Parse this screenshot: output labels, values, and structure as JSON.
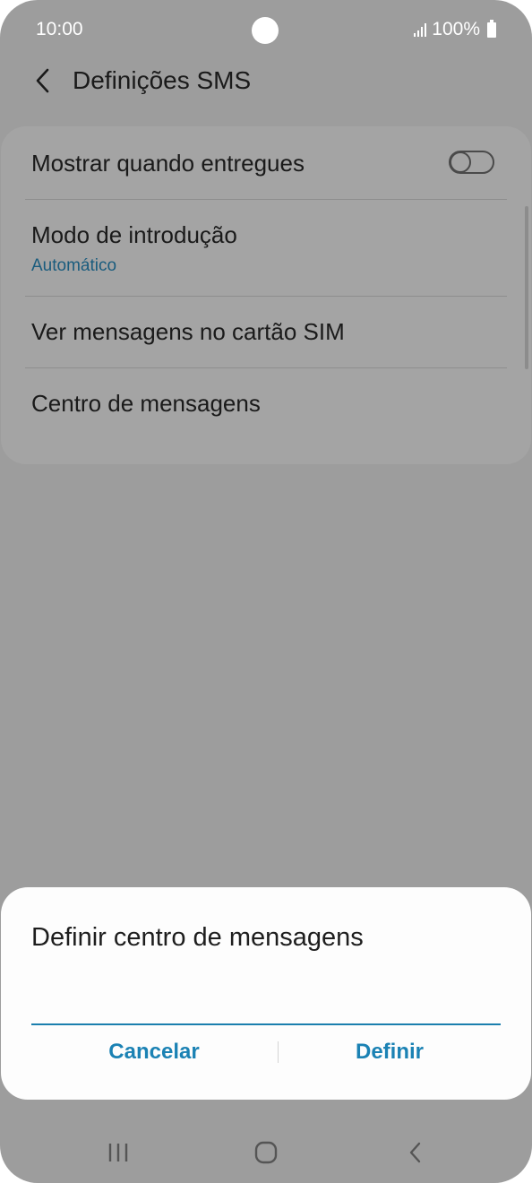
{
  "status_bar": {
    "time": "10:00",
    "battery": "100%"
  },
  "header": {
    "title": "Definições SMS"
  },
  "settings": {
    "items": [
      {
        "label": "Mostrar quando entregues",
        "toggle_on": false
      },
      {
        "label": "Modo de introdução",
        "sublabel": "Automático"
      },
      {
        "label": "Ver mensagens no cartão SIM"
      },
      {
        "label": "Centro de mensagens"
      }
    ]
  },
  "dialog": {
    "title": "Definir centro de mensagens",
    "input_value": "",
    "cancel_label": "Cancelar",
    "confirm_label": "Definir"
  },
  "colors": {
    "accent": "#1b82b4",
    "scrim_background": "#9d9d9d",
    "dialog_background": "#fdfdfd"
  },
  "icons": {
    "back": "chevron-left-icon",
    "nav_recents": "recents-icon",
    "nav_home": "home-icon",
    "nav_back": "nav-back-icon"
  }
}
